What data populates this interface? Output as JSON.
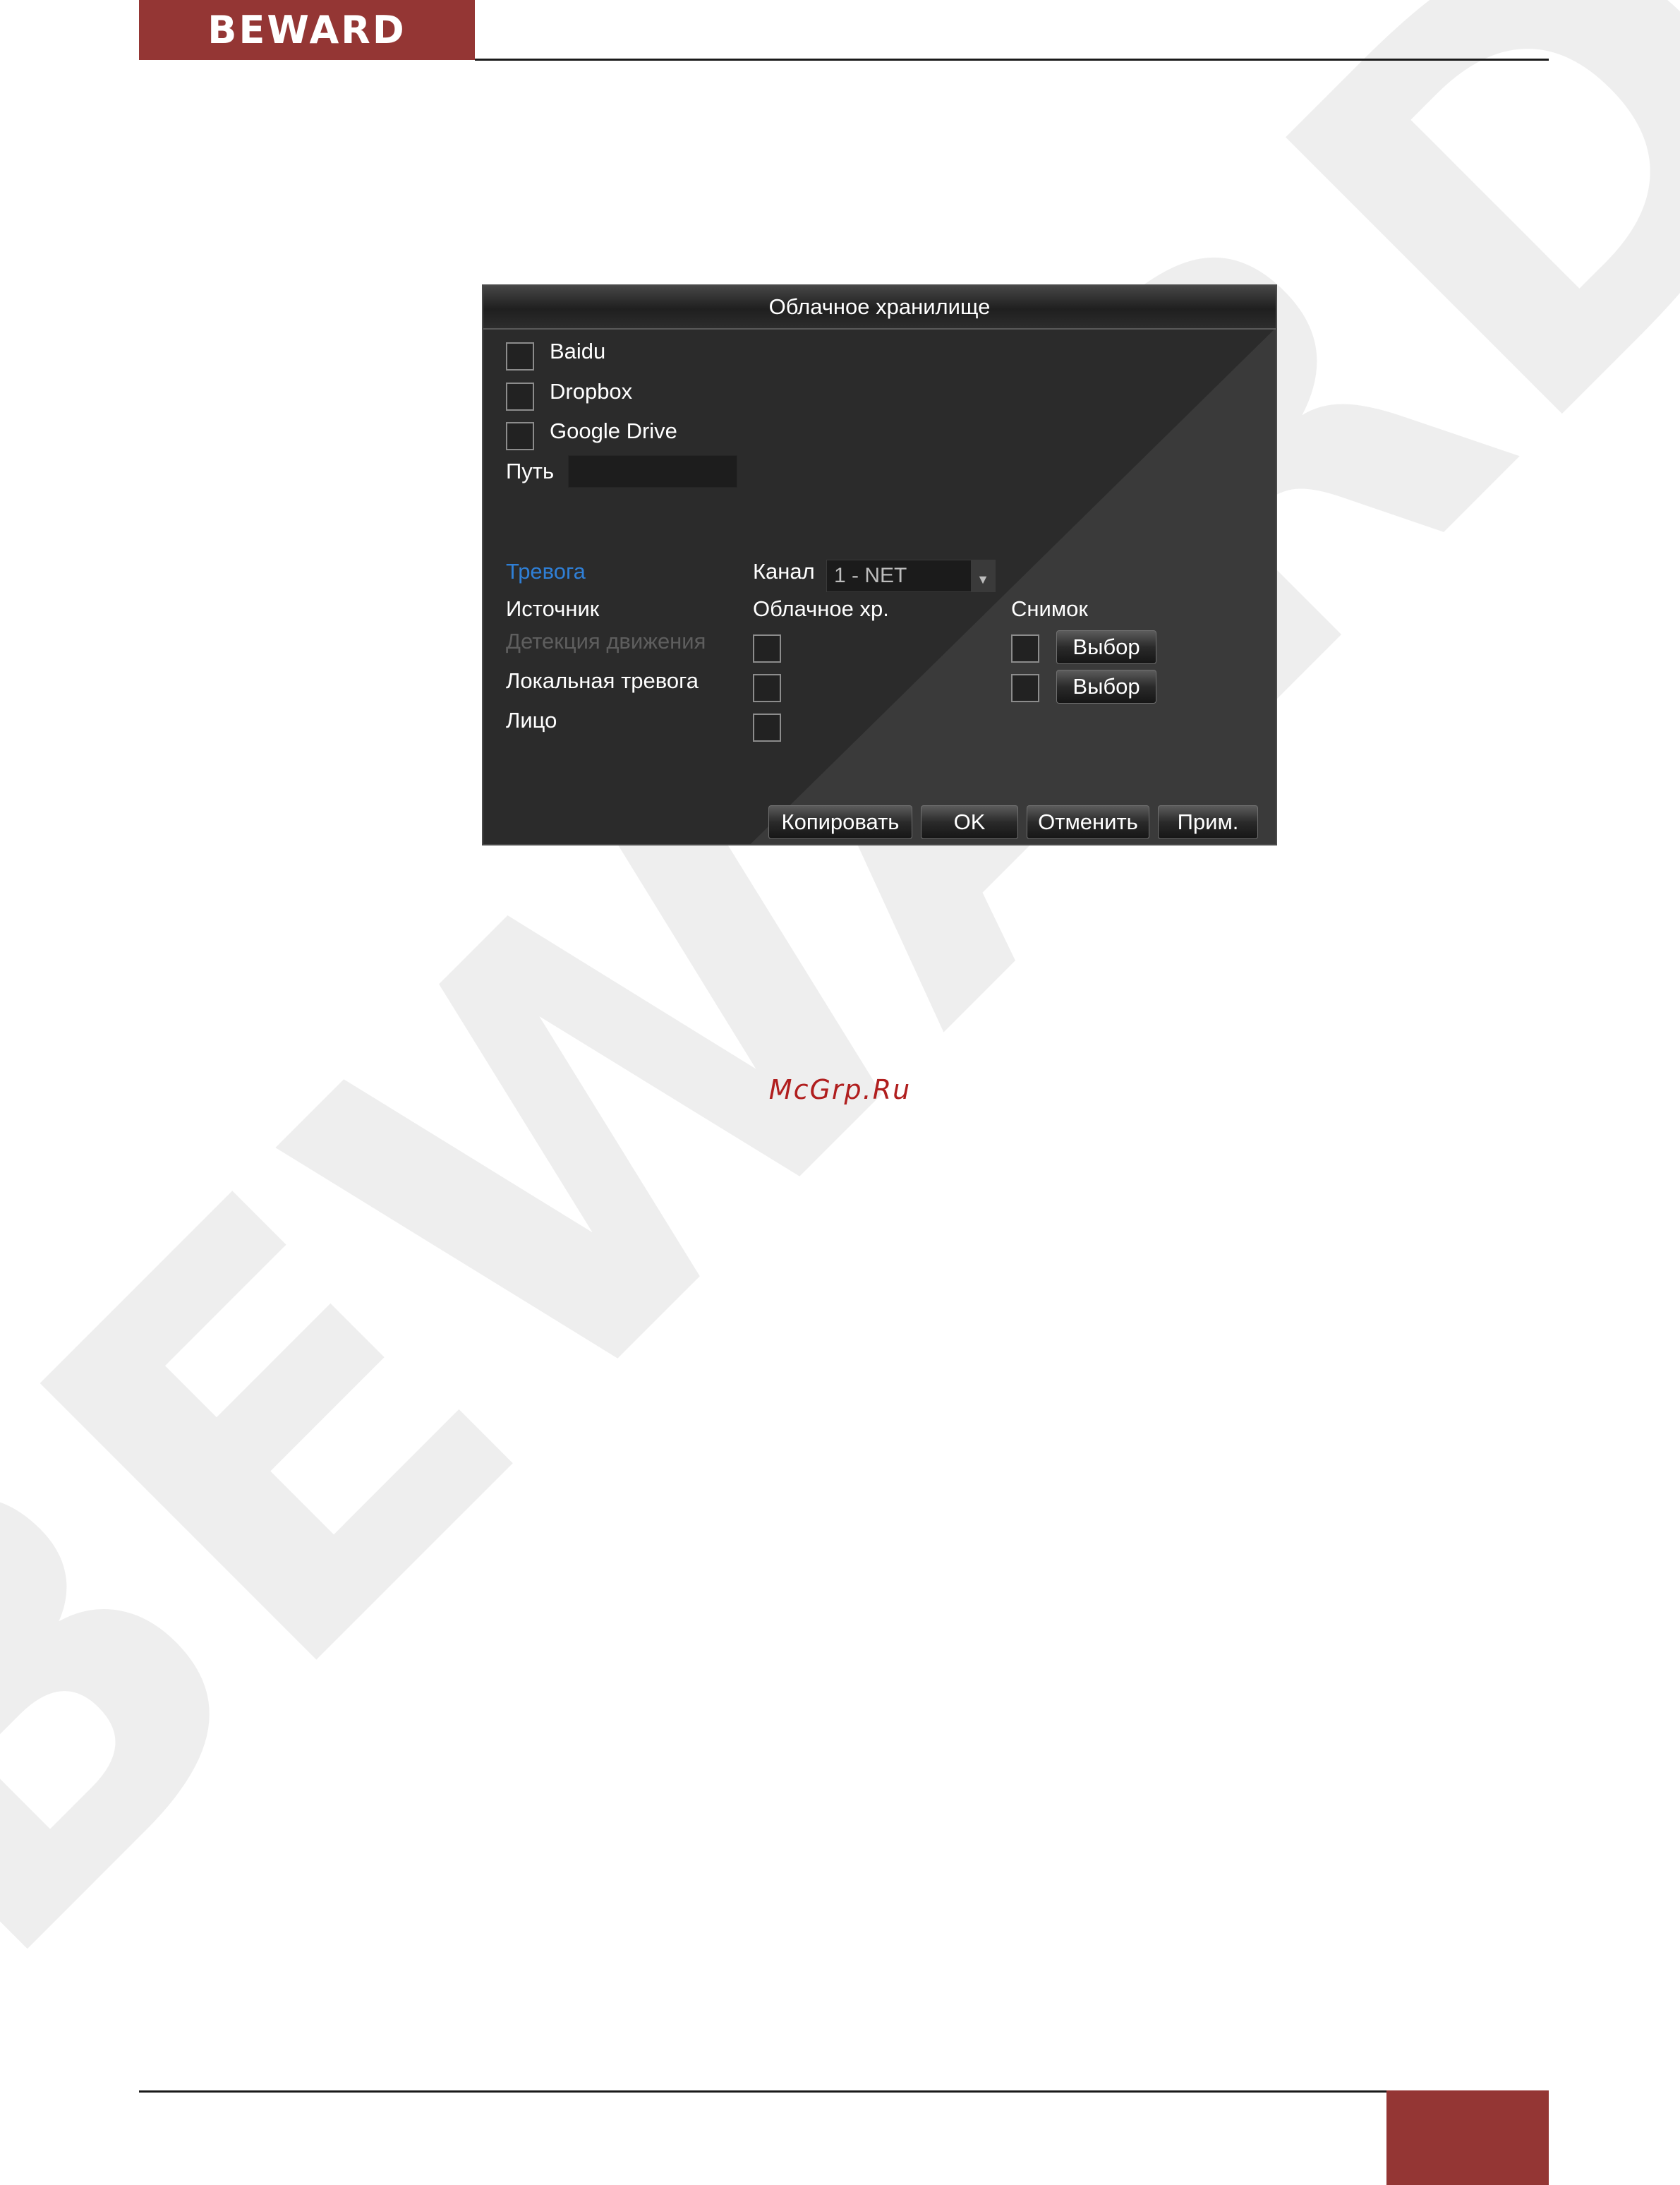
{
  "header": {
    "logo_text": "BEWARD"
  },
  "watermark": {
    "text": "BEWARD"
  },
  "dialog": {
    "title": "Облачное хранилище",
    "services": [
      {
        "label": "Baidu",
        "checked": false
      },
      {
        "label": "Dropbox",
        "checked": false
      },
      {
        "label": "Google Drive",
        "checked": false
      }
    ],
    "path_label": "Путь",
    "path_value": "",
    "alarm_tab": "Тревога",
    "channel_label": "Канал",
    "channel_value": "1 - NET",
    "columns": {
      "source": "Источник",
      "cloud": "Облачное хр.",
      "snapshot": "Снимок"
    },
    "rows": [
      {
        "source": "Детекция движения",
        "disabled": true,
        "cloud": false,
        "snapshot": false,
        "select_label": "Выбор"
      },
      {
        "source": "Локальная тревога",
        "disabled": false,
        "cloud": false,
        "snapshot": false,
        "select_label": "Выбор"
      },
      {
        "source": "Лицо",
        "disabled": false,
        "cloud": false
      }
    ],
    "buttons": {
      "copy": "Копировать",
      "ok": "OK",
      "cancel": "Отменить",
      "apply": "Прим."
    }
  },
  "footer": {
    "site": "McGrp.Ru"
  },
  "colors": {
    "brand": "#943634",
    "dialog_bg": "#2b2b2b",
    "accent_blue": "#2f7fd6",
    "link_red": "#b01e1e"
  }
}
